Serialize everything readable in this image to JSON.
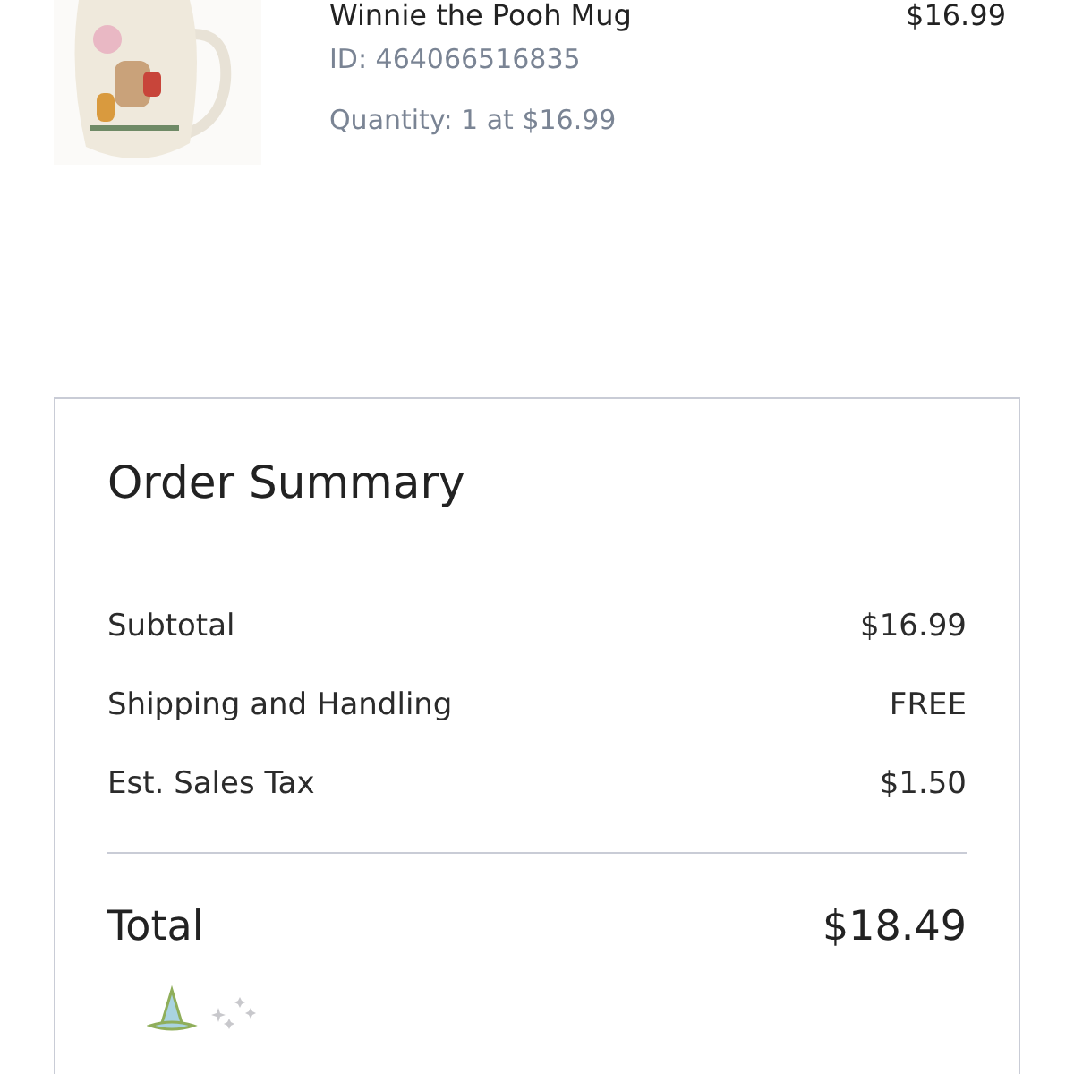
{
  "item": {
    "kind": "picture",
    "name": "Winnie the Pooh Mug",
    "price": "$16.99",
    "id": "ID: 464066516835",
    "quantity": "Quantity: 1 at $16.99"
  },
  "summary": {
    "title": "Order Summary",
    "rows": [
      {
        "label": "Subtotal",
        "value": "$16.99"
      },
      {
        "label": "Shipping and Handling",
        "value": "FREE"
      },
      {
        "label": "Est. Sales Tax",
        "value": "$1.50"
      }
    ],
    "total": {
      "label": "Total",
      "value": "$18.49"
    }
  }
}
